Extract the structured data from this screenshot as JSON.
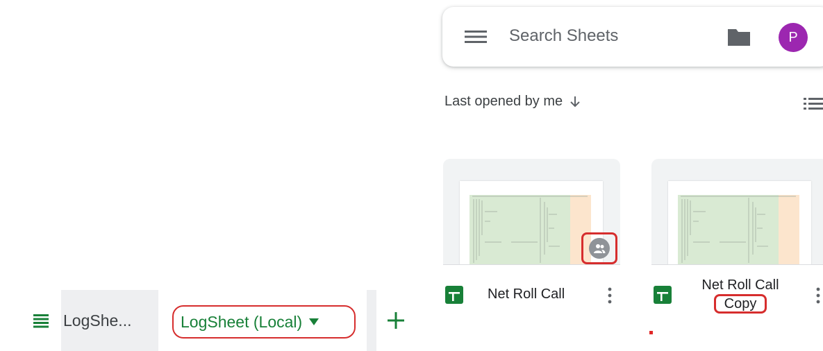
{
  "sheet_tabs": {
    "other_tab_label": "LogShe...",
    "active_tab_label": "LogSheet (Local)"
  },
  "search": {
    "placeholder": "Search Sheets",
    "avatar_letter": "P",
    "avatar_color": "#9c27b0"
  },
  "sort": {
    "label": "Last opened by me"
  },
  "files": [
    {
      "name": "Net Roll Call",
      "shared": true
    },
    {
      "name_line1": "Net Roll Call",
      "name_line2": "Copy",
      "shared": false
    }
  ],
  "colors": {
    "sheets_green": "#188038",
    "highlight_red": "#d62d2d",
    "tab_bg": "#eeeff1"
  },
  "icons": [
    "menu-icon",
    "add-icon",
    "hamburger-icon",
    "folder-icon",
    "sort-arrow-icon",
    "list-view-icon",
    "shared-people-icon",
    "sheets-file-icon",
    "more-vert-icon"
  ]
}
